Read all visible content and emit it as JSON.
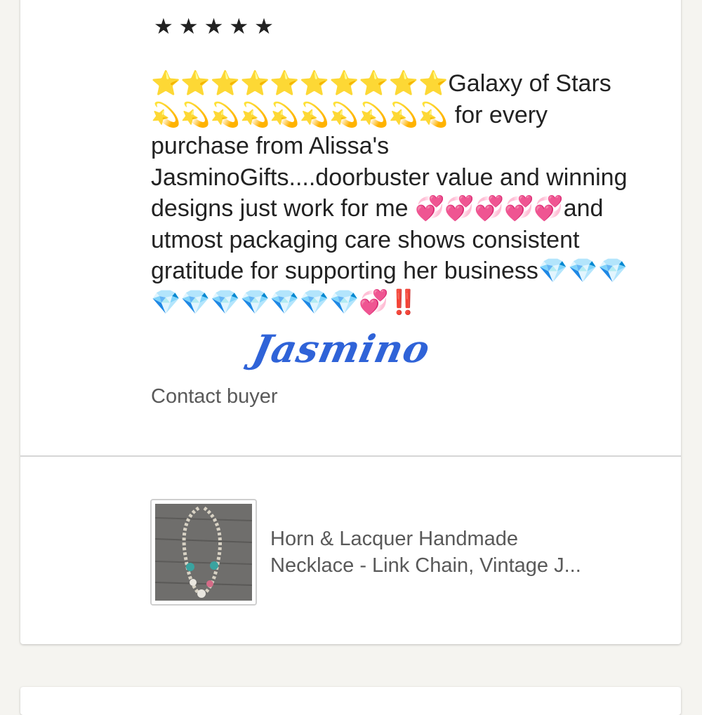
{
  "review": {
    "stars": "★★★★★",
    "text": "⭐⭐⭐⭐⭐⭐⭐⭐⭐⭐Galaxy of Stars💫💫💫💫💫💫💫💫💫💫 for every purchase from Alissa's JasminoGifts....doorbuster value and winning designs just work for me 💞💞💞💞💞and utmost packaging care shows consistent gratitude for supporting her business💎💎💎💎💎💎💎💎💎💎💞‼️",
    "signature": "Jasmino",
    "contact_label": "Contact buyer"
  },
  "listing": {
    "title_line1": "Horn & Lacquer Handmade",
    "title_line2": "Necklace - Link Chain, Vintage J...",
    "thumbnail_icon": "necklace-photo"
  },
  "colors": {
    "background": "#f5f4f0",
    "card": "#ffffff",
    "text": "#222222",
    "muted": "#595959",
    "signature": "#2f63d8"
  }
}
